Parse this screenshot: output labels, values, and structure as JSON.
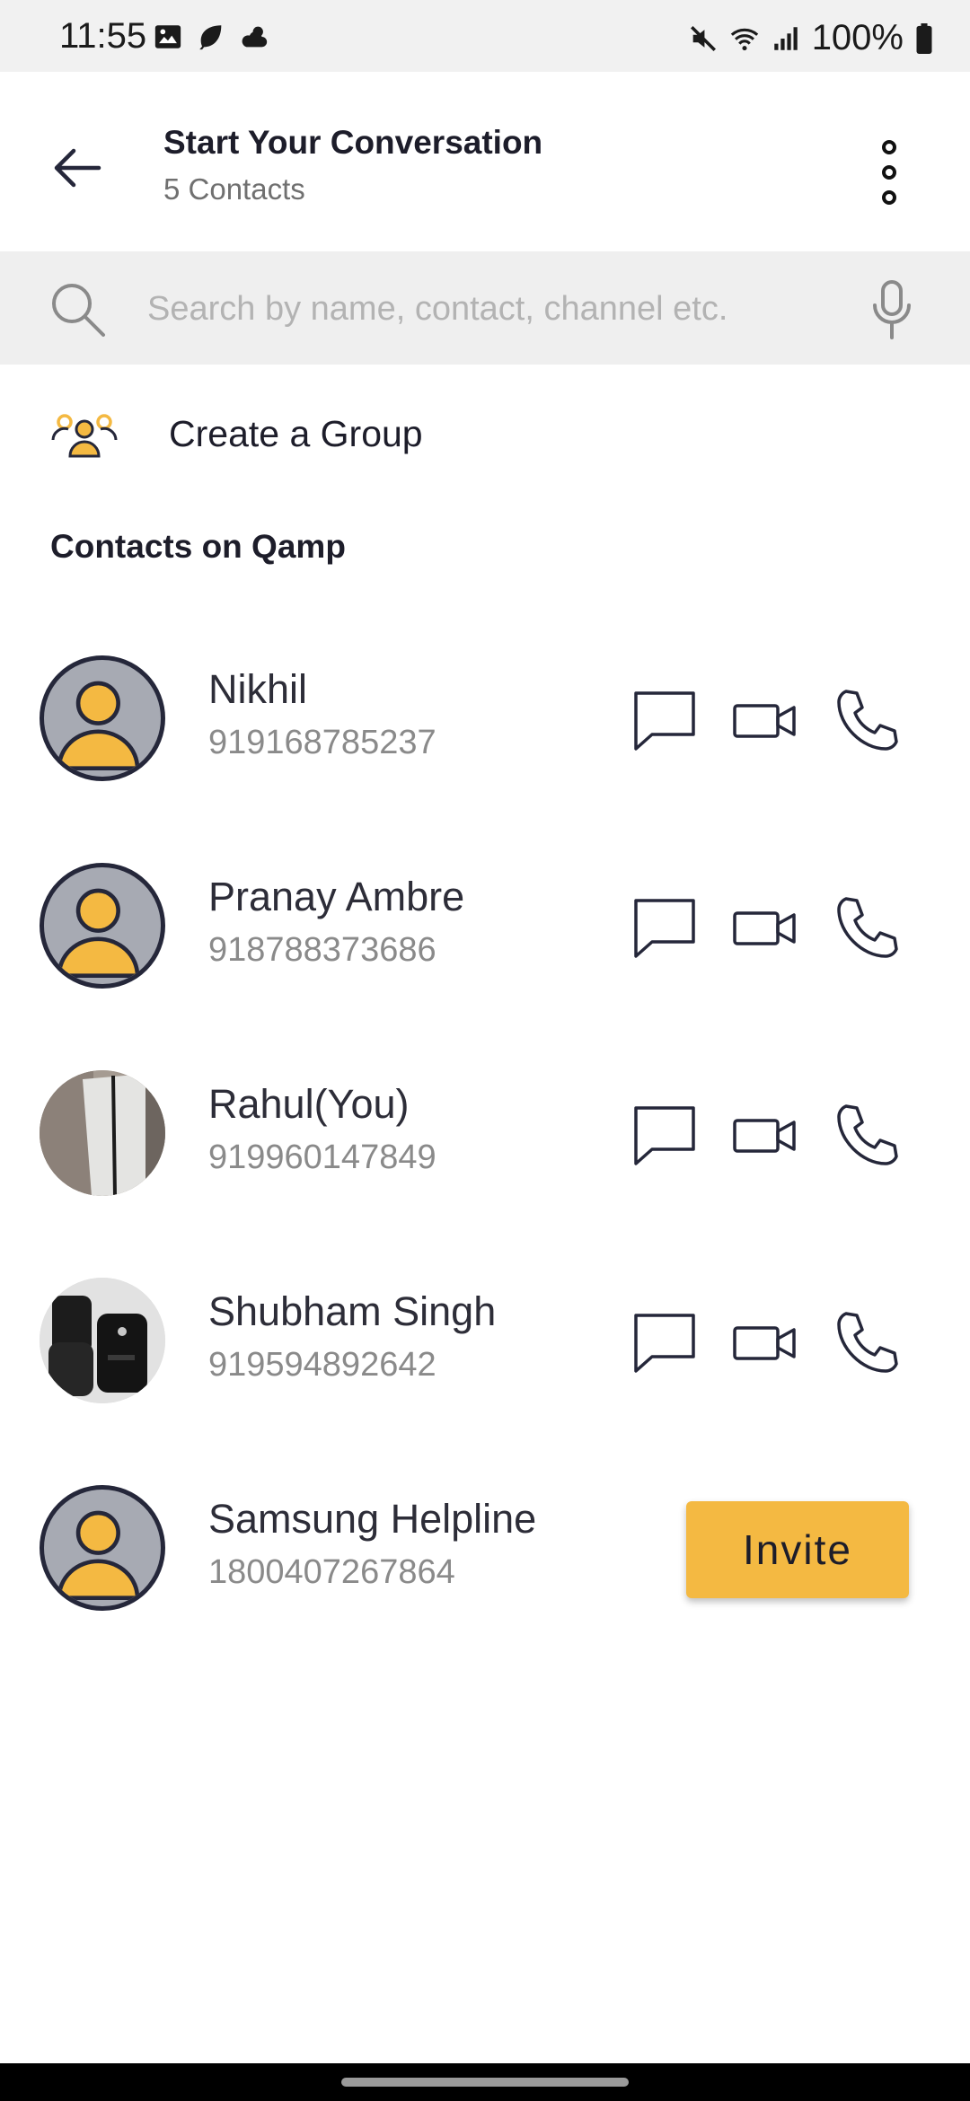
{
  "status_bar": {
    "time": "11:55",
    "battery": "100%",
    "left_icons": [
      "image-icon",
      "leaf-icon",
      "weather-icon"
    ],
    "right_icons": [
      "mute-icon",
      "wifi-icon",
      "signal-icon",
      "battery-icon"
    ]
  },
  "header": {
    "title": "Start Your Conversation",
    "subtitle": "5 Contacts"
  },
  "search": {
    "placeholder": "Search by name, contact, channel etc."
  },
  "create_group": {
    "label": "Create a Group"
  },
  "section": {
    "title": "Contacts on Qamp"
  },
  "contacts": [
    {
      "name": "Nikhil",
      "number": "919168785237",
      "avatar": "default"
    },
    {
      "name": "Pranay Ambre",
      "number": "918788373686",
      "avatar": "default"
    },
    {
      "name": "Rahul(You)",
      "number": "919960147849",
      "avatar": "photo"
    },
    {
      "name": "Shubham Singh",
      "number": "919594892642",
      "avatar": "photo"
    },
    {
      "name": "Samsung Helpline",
      "number": "1800407267864",
      "avatar": "default",
      "invite_label": "Invite"
    }
  ],
  "colors": {
    "accent": "#f4b942",
    "icon_stroke": "#25273a",
    "avatar_bg": "#a7aab3"
  }
}
